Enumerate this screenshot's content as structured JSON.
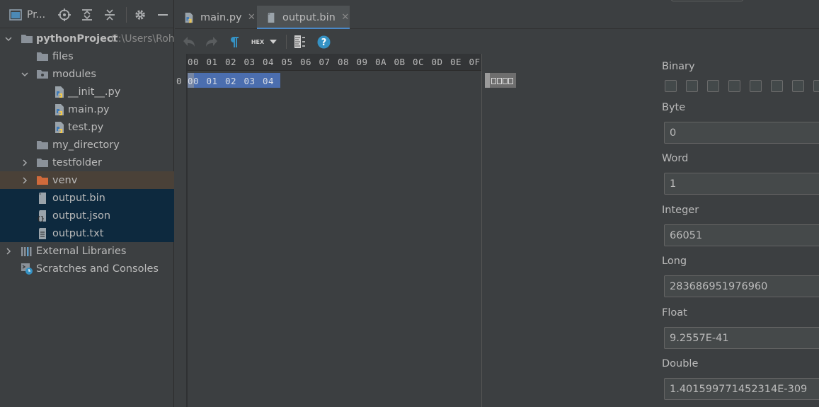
{
  "project_panel": {
    "title": "Pr...",
    "tree": [
      {
        "label": "pythonProject",
        "path": "C:\\Users\\Rohi",
        "icon": "folder-icon",
        "arrow": "expanded"
      },
      {
        "label": "files",
        "icon": "folder-icon",
        "arrow": "none"
      },
      {
        "label": "modules",
        "icon": "package-folder-icon",
        "arrow": "expanded"
      },
      {
        "label": "__init__.py",
        "icon": "python-file-icon",
        "arrow": "none"
      },
      {
        "label": "main.py",
        "icon": "python-file-icon",
        "arrow": "none"
      },
      {
        "label": "test.py",
        "icon": "python-file-icon",
        "arrow": "none"
      },
      {
        "label": "my_directory",
        "icon": "folder-icon",
        "arrow": "none"
      },
      {
        "label": "testfolder",
        "icon": "folder-icon",
        "arrow": "collapsed"
      },
      {
        "label": "venv",
        "icon": "excluded-folder-icon",
        "arrow": "collapsed"
      },
      {
        "label": "output.bin",
        "icon": "file-icon",
        "arrow": "none"
      },
      {
        "label": "output.json",
        "icon": "json-file-icon",
        "arrow": "none"
      },
      {
        "label": "output.txt",
        "icon": "text-file-icon",
        "arrow": "none"
      },
      {
        "label": "External Libraries",
        "icon": "library-icon",
        "arrow": "collapsed"
      },
      {
        "label": "Scratches and Consoles",
        "icon": "scratches-icon",
        "arrow": "none"
      }
    ]
  },
  "tabs": [
    {
      "label": "main.py",
      "icon": "python-file-icon",
      "active": false
    },
    {
      "label": "output.bin",
      "icon": "file-icon",
      "active": true
    }
  ],
  "toolbar": {
    "mode_label": "HEX",
    "icons": [
      "undo-icon",
      "redo-icon",
      "pilcrow-icon",
      "hex-mode-icon",
      "dropdown-arrow-icon",
      "settings-list-icon",
      "help-icon"
    ]
  },
  "hex_editor": {
    "columns": [
      "00",
      "01",
      "02",
      "03",
      "04",
      "05",
      "06",
      "07",
      "08",
      "09",
      "0A",
      "0B",
      "0C",
      "0D",
      "0E",
      "0F"
    ],
    "row_offset": "0",
    "bytes": [
      "00",
      "01",
      "02",
      "03",
      "04"
    ],
    "selected_byte_count": 5
  },
  "inspector": {
    "binary_label": "Binary",
    "binary_bit_count": 8,
    "byte_label": "Byte",
    "byte_value": "0",
    "word_label": "Word",
    "word_value": "1",
    "integer_label": "Integer",
    "integer_value": "66051",
    "long_label": "Long",
    "long_value": "283686951976960",
    "float_label": "Float",
    "float_value": "9.2557E-41",
    "double_label": "Double",
    "double_value": "1.401599771452314E-309"
  },
  "colors": {
    "background": "#3c3f41",
    "selection_blue": "#4b6eaf",
    "tab_underline": "#4a88c7",
    "tree_highlight_blue": "#0d293e",
    "tree_highlight_brown": "#4a4138",
    "help_blue": "#3592c4"
  }
}
